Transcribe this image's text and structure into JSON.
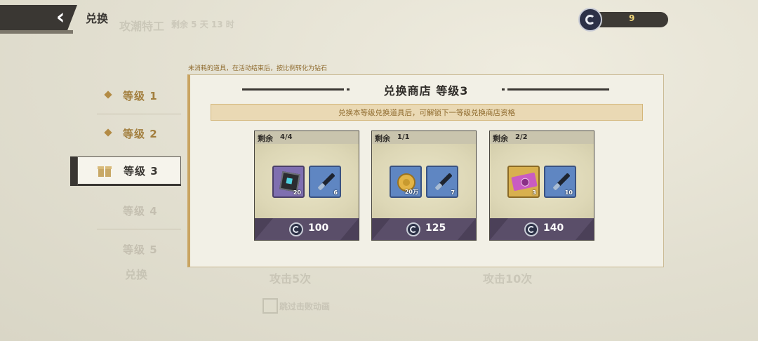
{
  "header": {
    "back_icon": "back-arrow-icon",
    "title": "兑换",
    "currency": {
      "icon": "token-coin-icon",
      "value": "9"
    }
  },
  "background_ghost_text": {
    "event_name": "攻潮特工",
    "remaining": "剩余 5 天 13 时",
    "lower_left": "兑换",
    "challenge_a": "攻击5次",
    "challenge_b": "攻击10次",
    "checkbox_label": "跳过击败动画"
  },
  "notice": "未消耗的道具，在活动结束后，按比例转化为钻石",
  "sidebar": {
    "tabs": [
      {
        "label": "等级 1",
        "state": "unlocked"
      },
      {
        "label": "等级 2",
        "state": "unlocked"
      },
      {
        "label": "等级 3",
        "state": "selected"
      },
      {
        "label": "等级 4",
        "state": "locked"
      },
      {
        "label": "等级 5",
        "state": "locked"
      }
    ]
  },
  "shop": {
    "title": "兑换商店 等级3",
    "banner": "兑换本等级兑换道具后，可解锁下一等级兑换商店资格",
    "remain_label": "剩余",
    "cards": [
      {
        "remaining": "4/4",
        "items": [
          {
            "icon": "dark-cube-icon",
            "qty": "20",
            "rarity": "purple"
          },
          {
            "icon": "brush-icon",
            "qty": "6",
            "rarity": "blue"
          }
        ],
        "price": "100"
      },
      {
        "remaining": "1/1",
        "items": [
          {
            "icon": "gold-coin-icon",
            "qty": "20万",
            "rarity": "blue"
          },
          {
            "icon": "brush-icon",
            "qty": "7",
            "rarity": "blue"
          }
        ],
        "price": "125"
      },
      {
        "remaining": "2/2",
        "items": [
          {
            "icon": "ticket-icon",
            "qty": "3",
            "rarity": "gold"
          },
          {
            "icon": "brush-icon",
            "qty": "10",
            "rarity": "blue"
          }
        ],
        "price": "140"
      }
    ]
  },
  "colors": {
    "dark": "#3a3733",
    "accent_gold": "#c9a461",
    "panel_bg": "#f2f0e6",
    "card_footer": "#5a4e69",
    "currency_text": "#f0d67a"
  }
}
